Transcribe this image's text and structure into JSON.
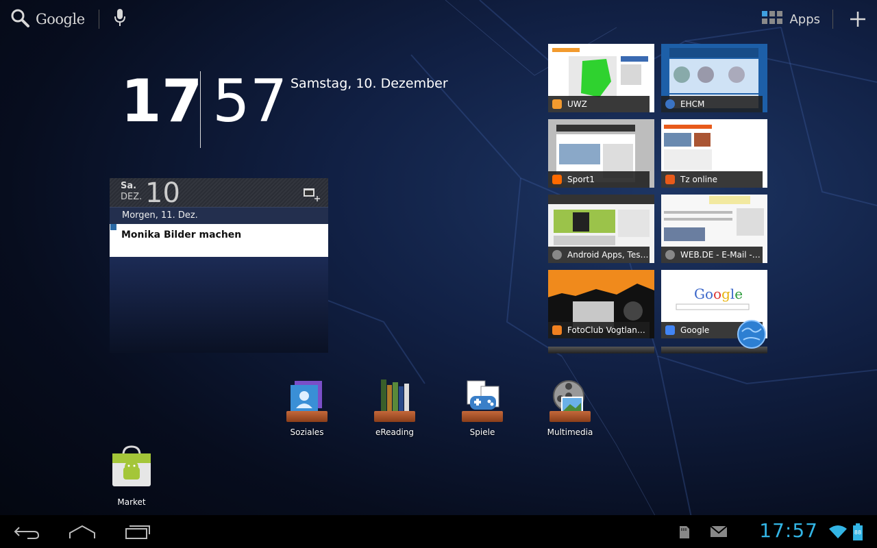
{
  "top_bar": {
    "search_label": "Google",
    "apps_label": "Apps"
  },
  "clock": {
    "hours": "17",
    "minutes": "57",
    "date": "Samstag, 10. Dezember"
  },
  "calendar": {
    "day_abbr": "Sa.",
    "month_abbr": "DEZ.",
    "day_number": "10",
    "next_day": "Morgen, 11. Dez.",
    "event": "Monika Bilder machen",
    "accent_color": "#2b6aa6"
  },
  "bookmarks": [
    {
      "title": "UWZ",
      "icon": "uwz-favicon",
      "color": "#f29a2e"
    },
    {
      "title": "EHCM",
      "icon": "ehcm-favicon",
      "color": "#3a73c4"
    },
    {
      "title": "Sport1",
      "icon": "sport1-favicon",
      "color": "#ff6a00"
    },
    {
      "title": "Tz online",
      "icon": "tz-favicon",
      "color": "#e85a1a"
    },
    {
      "title": "Android Apps, Tests...",
      "icon": "globe-favicon",
      "color": "#888888"
    },
    {
      "title": "WEB.DE - E-Mail - S...",
      "icon": "globe-favicon",
      "color": "#888888"
    },
    {
      "title": "FotoClub Vogtland ...",
      "icon": "fotoclub-favicon",
      "color": "#f08020"
    },
    {
      "title": "Google",
      "icon": "google-favicon",
      "color": "#4285f4"
    }
  ],
  "folders": [
    {
      "label": "Soziales",
      "icon": "contacts-folder-icon"
    },
    {
      "label": "eReading",
      "icon": "books-folder-icon"
    },
    {
      "label": "Spiele",
      "icon": "games-folder-icon"
    },
    {
      "label": "Multimedia",
      "icon": "multimedia-folder-icon"
    }
  ],
  "market": {
    "label": "Market"
  },
  "status_bar": {
    "time": "17:57",
    "battery": "88",
    "accent": "#33b5e5"
  }
}
